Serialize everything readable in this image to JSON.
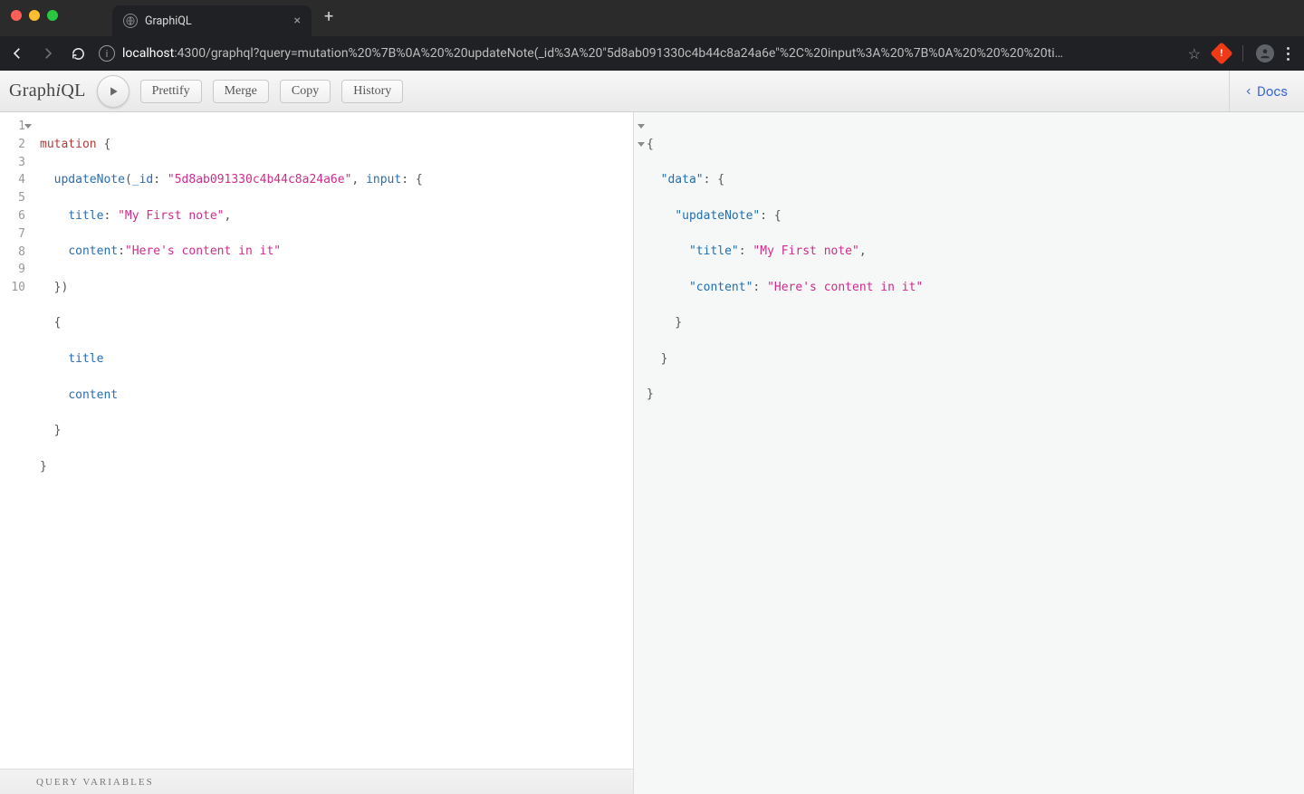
{
  "browser": {
    "tab_title": "GraphiQL",
    "url_host": "localhost",
    "url_port_path": ":4300/graphql?query=mutation%20%7B%0A%20%20updateNote(_id%3A%20\"5d8ab091330c4b44c8a24a6e\"%2C%20input%3A%20%7B%0A%20%20%20%20ti…"
  },
  "toolbar": {
    "logo_prefix": "Graph",
    "logo_em": "i",
    "logo_suffix": "QL",
    "prettify": "Prettify",
    "merge": "Merge",
    "copy": "Copy",
    "history": "History",
    "docs": "Docs"
  },
  "editor": {
    "line_numbers": [
      "1",
      "2",
      "3",
      "4",
      "5",
      "6",
      "7",
      "8",
      "9",
      "10"
    ],
    "query": {
      "l1_kw": "mutation",
      "l1_brace": " {",
      "l2_indent": "  ",
      "l2_fn": "updateNote",
      "l2_open": "(",
      "l2_arg1": "_id",
      "l2_colon1": ": ",
      "l2_id": "\"5d8ab091330c4b44c8a24a6e\"",
      "l2_comma": ", ",
      "l2_arg2": "input",
      "l2_colon2": ": {",
      "l3_indent": "    ",
      "l3_key": "title",
      "l3_colon": ": ",
      "l3_val": "\"My First note\"",
      "l3_comma": ",",
      "l4_indent": "    ",
      "l4_key": "content",
      "l4_colon": ":",
      "l4_val": "\"Here's content in it\"",
      "l5": "  })",
      "l6": "  {",
      "l7_indent": "    ",
      "l7_field": "title",
      "l8_indent": "    ",
      "l8_field": "content",
      "l9": "  }",
      "l10": "}"
    }
  },
  "vars_label": "Query Variables",
  "result": {
    "l1": "{",
    "l2_indent": "  ",
    "l2_key": "\"data\"",
    "l2_after": ": {",
    "l3_indent": "    ",
    "l3_key": "\"updateNote\"",
    "l3_after": ": {",
    "l4_indent": "      ",
    "l4_key": "\"title\"",
    "l4_colon": ": ",
    "l4_val": "\"My First note\"",
    "l4_comma": ",",
    "l5_indent": "      ",
    "l5_key": "\"content\"",
    "l5_colon": ": ",
    "l5_val": "\"Here's content in it\"",
    "l6": "    }",
    "l7": "  }",
    "l8": "}"
  }
}
